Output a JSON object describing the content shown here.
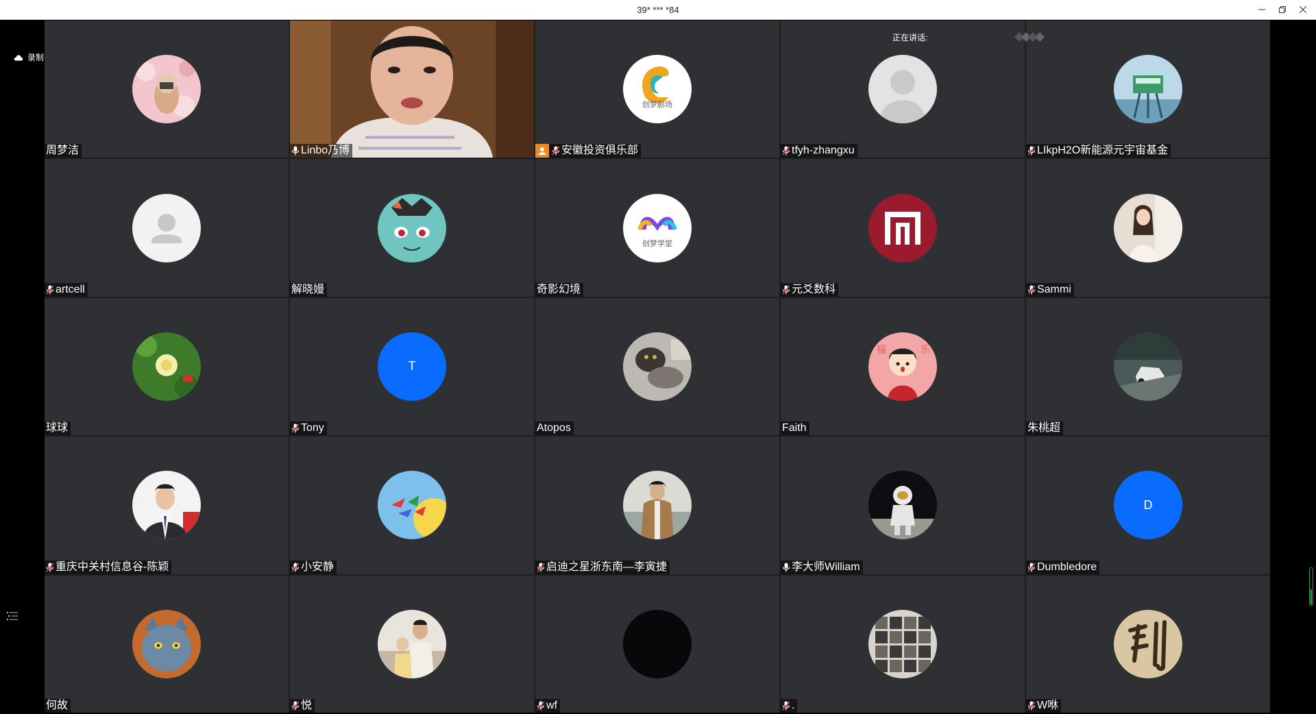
{
  "window": {
    "title": "39* *** *84",
    "controls": [
      "minimize-icon",
      "restore-icon",
      "close-icon"
    ]
  },
  "recording": {
    "label": "录制中",
    "icon": "cloud-icon"
  },
  "speaking": {
    "label": "正在讲话:"
  },
  "sidebar": {
    "list_icon": "list-icon"
  },
  "colors": {
    "tile_bg": "#2e3033",
    "muted_mic": "#e0393e",
    "host_badge": "#f08a24",
    "letter_avatar_blue": "#0a6cff",
    "scroll_green": "#2fa84f"
  },
  "participants": [
    {
      "name": "周梦洁",
      "mic": "none",
      "avatar": "photo-blossom"
    },
    {
      "name": "Linbo乃博",
      "mic": "on",
      "avatar": "video"
    },
    {
      "name": "安徽投资俱乐部",
      "mic": "muted",
      "host": true,
      "avatar": "logo-chuangmeng-theater",
      "avatar_text": "创梦剧场"
    },
    {
      "name": "tfyh-zhangxu",
      "mic": "muted",
      "avatar": "default-grey-large"
    },
    {
      "name": "LIkpH2O新能源元宇宙基金",
      "mic": "muted",
      "avatar": "photo-tower"
    },
    {
      "name": "artcell",
      "mic": "muted",
      "avatar": "default-grey"
    },
    {
      "name": "解晓嫚",
      "mic": "none",
      "avatar": "cartoon-bulbasaur"
    },
    {
      "name": "奇影幻境",
      "mic": "none",
      "avatar": "logo-chuangmeng-school",
      "avatar_text": "创梦学堂"
    },
    {
      "name": "元爻数科",
      "mic": "muted",
      "avatar": "logo-red-in"
    },
    {
      "name": "Sammi",
      "mic": "muted",
      "avatar": "photo-woman"
    },
    {
      "name": "球球",
      "mic": "none",
      "avatar": "photo-flower"
    },
    {
      "name": "Tony",
      "mic": "muted",
      "avatar": "letter",
      "letter": "T"
    },
    {
      "name": "Atopos",
      "mic": "none",
      "avatar": "photo-cat"
    },
    {
      "name": "Faith",
      "mic": "none",
      "avatar": "cartoon-boy"
    },
    {
      "name": "朱桃超",
      "mic": "none",
      "avatar": "photo-car"
    },
    {
      "name": "重庆中关村信息谷-陈颖",
      "mic": "muted",
      "avatar": "photo-man-suit"
    },
    {
      "name": "小安静",
      "mic": "muted",
      "avatar": "photo-sky-birds"
    },
    {
      "name": "启迪之星浙东南—李寅捷",
      "mic": "muted",
      "avatar": "photo-man-coat"
    },
    {
      "name": "李大师William",
      "mic": "on",
      "avatar": "photo-astronaut"
    },
    {
      "name": "Dumbledore",
      "mic": "muted",
      "avatar": "letter",
      "letter": "D"
    },
    {
      "name": "何故",
      "mic": "none",
      "avatar": "photo-blue-cat"
    },
    {
      "name": "悦",
      "mic": "muted",
      "avatar": "photo-family"
    },
    {
      "name": "wf",
      "mic": "muted",
      "avatar": "black"
    },
    {
      "name": ".",
      "mic": "muted",
      "avatar": "photo-collage"
    },
    {
      "name": "W咻",
      "mic": "muted",
      "avatar": "calligraphy"
    }
  ]
}
